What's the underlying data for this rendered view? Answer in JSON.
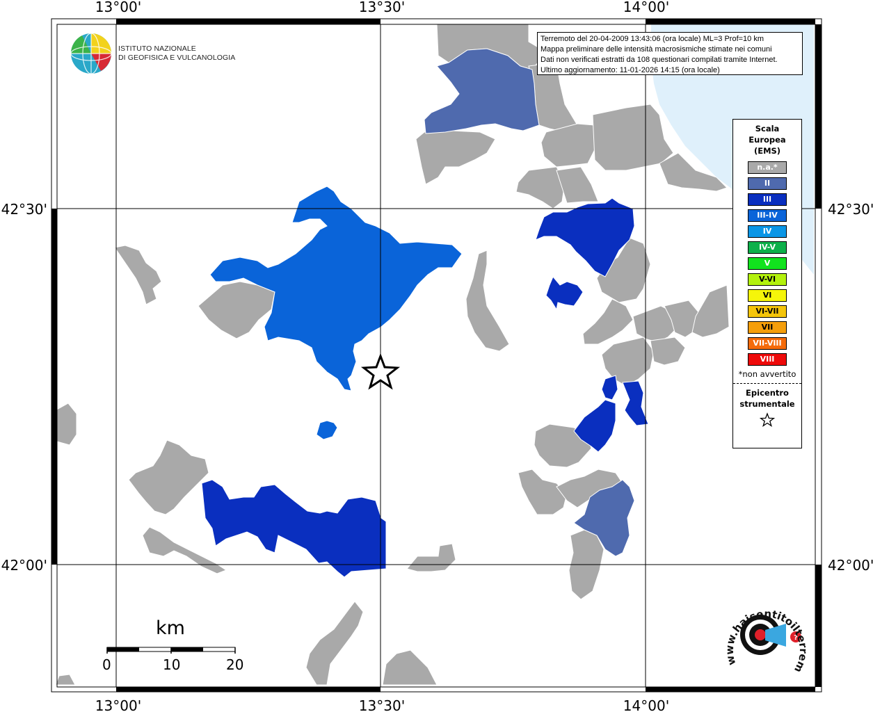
{
  "axes": {
    "lon_labels": [
      "13°00'",
      "13°30'",
      "14°00'"
    ],
    "lat_labels": [
      "42°30'",
      "42°00'"
    ]
  },
  "info_box": {
    "lines": [
      "Terremoto del 20-04-2009 13:43:06 (ora locale) ML=3 Prof=10 km",
      "Mappa preliminare delle intensità macrosismiche stimate nei comuni",
      "Dati non verificati estratti da 108 questionari compilati tramite Internet.",
      "Ultimo aggiornamento: 11-01-2026 14:15 (ora locale)"
    ]
  },
  "logo": {
    "line1": "ISTITUTO NAZIONALE",
    "line2": "DI GEOFISICA E VULCANOLOGIA",
    "hst_text": "www.haisentitoilterremoto.it"
  },
  "legend": {
    "title_lines": [
      "Scala",
      "Europea",
      "(EMS)"
    ],
    "items": [
      {
        "label": "n.a.*",
        "color": "#a9a9a9"
      },
      {
        "label": "II",
        "color": "#4f6aae"
      },
      {
        "label": "III",
        "color": "#0a2fbf"
      },
      {
        "label": "III-IV",
        "color": "#0a64d9"
      },
      {
        "label": "IV",
        "color": "#0a96e6"
      },
      {
        "label": "IV-V",
        "color": "#0db04a"
      },
      {
        "label": "V",
        "color": "#11e31e"
      },
      {
        "label": "V-VI",
        "color": "#b3f20d"
      },
      {
        "label": "VI",
        "color": "#f5f50a"
      },
      {
        "label": "VI-VII",
        "color": "#f5c50a"
      },
      {
        "label": "VII",
        "color": "#f59e0a"
      },
      {
        "label": "VII-VIII",
        "color": "#f56b0a"
      },
      {
        "label": "VIII",
        "color": "#ee0a0a"
      }
    ],
    "note": "*non avvertito",
    "epicenter_lines": [
      "Epicentro",
      "strumentale"
    ]
  },
  "scale_bar": {
    "unit": "km",
    "labels": [
      "0",
      "10",
      "20"
    ]
  },
  "colors": {
    "na": "#a9a9a9",
    "II": "#4f6aae",
    "III": "#0a2fbf",
    "III_IV": "#0a64d9",
    "sea": "#dff0fb"
  }
}
